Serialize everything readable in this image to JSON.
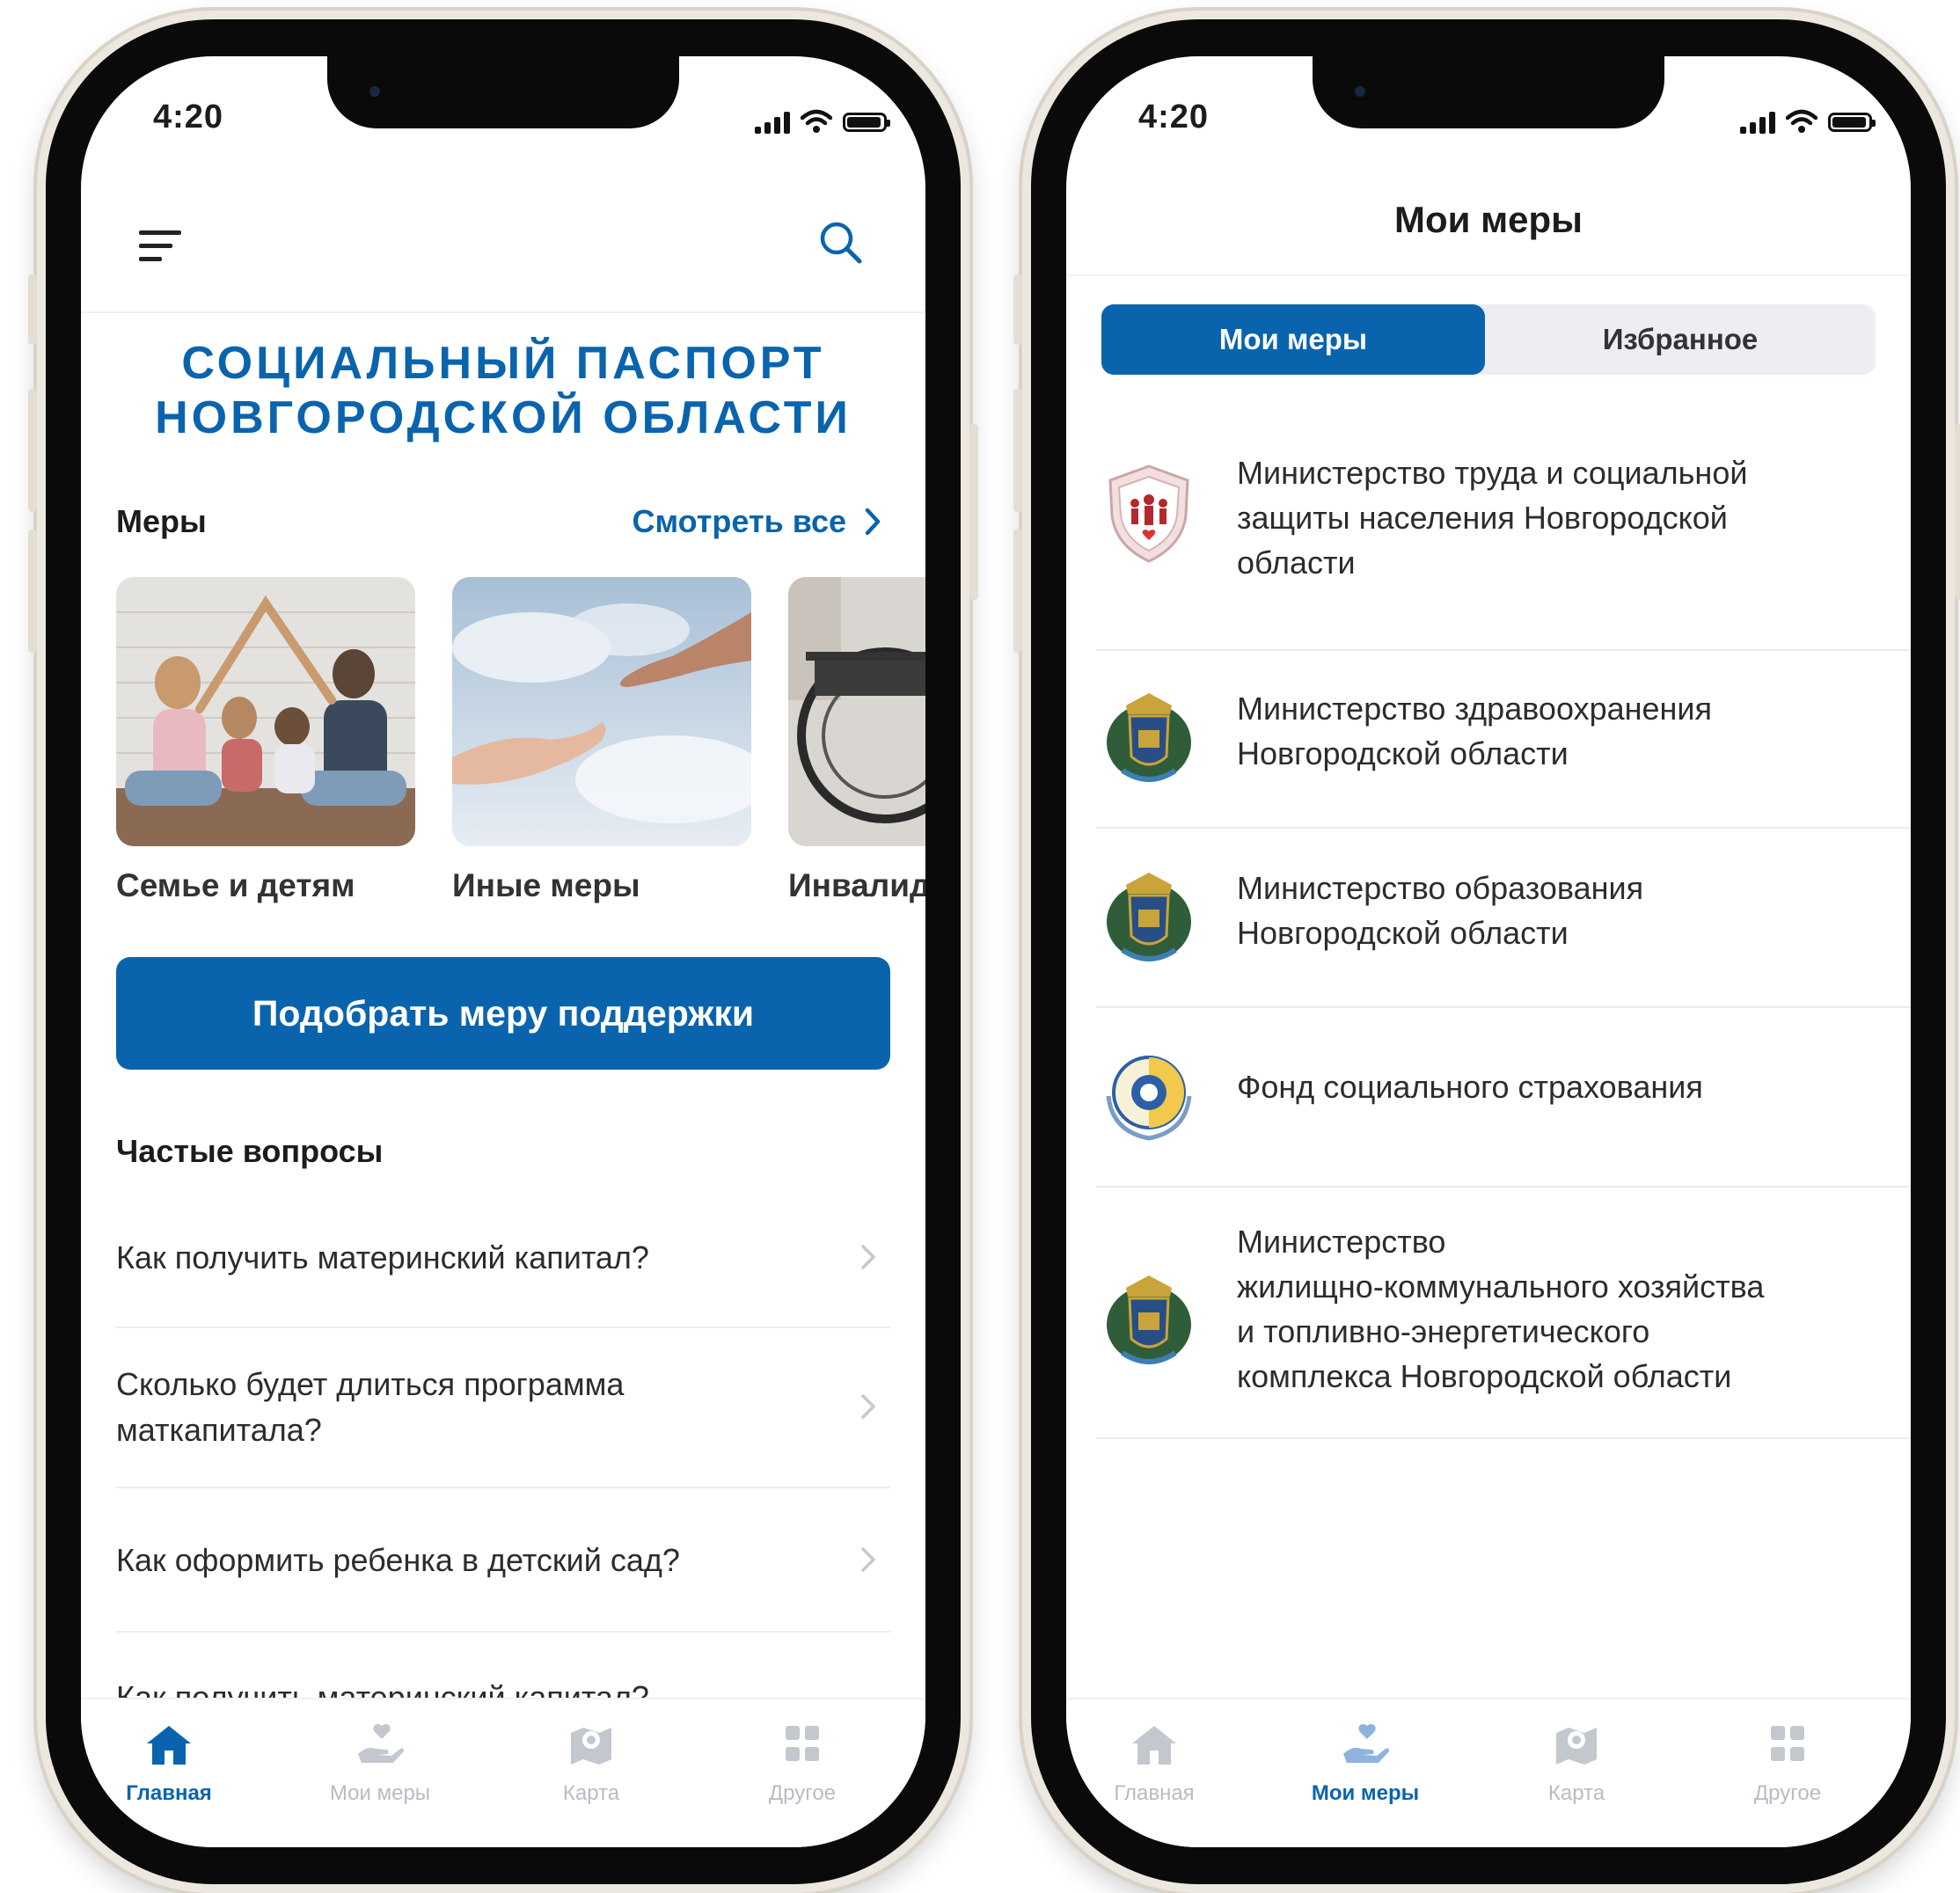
{
  "colors": {
    "accent": "#0a64ad",
    "inactive": "#b7bcc4"
  },
  "left_phone": {
    "status_time": "4:20",
    "title_line1": "СОЦИАЛЬНЫЙ ПАСПОРТ",
    "title_line2": "НОВГОРОДСКОЙ ОБЛАСТИ",
    "measures_section": "Меры",
    "see_all": "Смотреть все",
    "categories": [
      {
        "label": "Семье и детям",
        "image": "family-photo"
      },
      {
        "label": "Иные меры",
        "image": "helping-hands-photo"
      },
      {
        "label": "Инвалид",
        "image": "wheelchair-photo"
      }
    ],
    "cta_button": "Подобрать меру поддержки",
    "faq_section": "Частые вопросы",
    "faq": [
      {
        "q_line1": "Как получить материнский капитал?",
        "q_line2": ""
      },
      {
        "q_line1": "Сколько будет длиться программа",
        "q_line2": "маткапитала?"
      },
      {
        "q_line1": "Как оформить ребенка в детский сад?",
        "q_line2": ""
      },
      {
        "q_line1": "Как получить материнский капитал?",
        "q_line2": ""
      }
    ],
    "tabs": [
      {
        "label": "Главная",
        "icon": "home-icon",
        "active": true
      },
      {
        "label": "Мои меры",
        "icon": "hand-heart-icon",
        "active": false
      },
      {
        "label": "Карта",
        "icon": "map-icon",
        "active": false
      },
      {
        "label": "Другое",
        "icon": "grid-icon",
        "active": false
      }
    ]
  },
  "right_phone": {
    "status_time": "4:20",
    "screen_title": "Мои меры",
    "segment_active": "Мои меры",
    "segment_inactive": "Избранное",
    "organizations": [
      {
        "lines": [
          "Министерство труда и социальной",
          "защиты населения Новгородской",
          "области"
        ],
        "logo": "labor-ministry-emblem"
      },
      {
        "lines": [
          "Министерство здравоохранения",
          "Новгородской области"
        ],
        "logo": "novgorod-coat-of-arms"
      },
      {
        "lines": [
          "Министерство образования",
          "Новгородской области"
        ],
        "logo": "novgorod-coat-of-arms"
      },
      {
        "lines": [
          "Фонд социального страхования"
        ],
        "logo": "fss-emblem"
      },
      {
        "lines": [
          "Министерство",
          "жилищно-коммунального хозяйства",
          "и топливно-энергетического",
          "комплекса Новгородской области"
        ],
        "logo": "novgorod-coat-of-arms"
      }
    ],
    "tabs": [
      {
        "label": "Главная",
        "icon": "home-icon",
        "active": false
      },
      {
        "label": "Мои меры",
        "icon": "hand-heart-icon",
        "active": true
      },
      {
        "label": "Карта",
        "icon": "map-icon",
        "active": false
      },
      {
        "label": "Другое",
        "icon": "grid-icon",
        "active": false
      }
    ]
  }
}
